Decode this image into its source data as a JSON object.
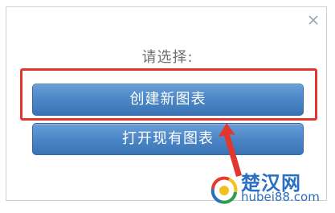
{
  "dialog": {
    "prompt": "请选择:",
    "buttons": {
      "create_label": "创建新图表",
      "open_label": "打开现有图表"
    },
    "close_icon": "close-icon"
  },
  "watermark": {
    "name": "楚汉网",
    "url": "hubei88.com"
  },
  "colors": {
    "button_blue": "#4b86c6",
    "highlight_red": "#e0372f",
    "prompt_gray": "#707070"
  }
}
